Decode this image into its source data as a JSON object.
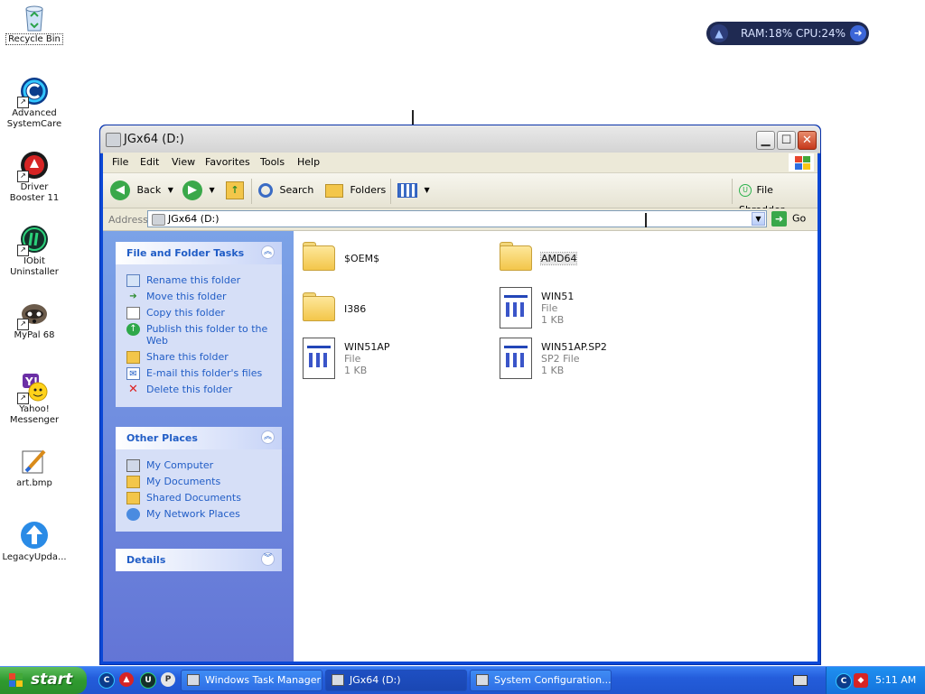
{
  "desktop": {
    "icons": [
      {
        "label": "Recycle Bin"
      },
      {
        "label": "Advanced SystemCare"
      },
      {
        "label": "Driver Booster 11"
      },
      {
        "label": "IObit Uninstaller"
      },
      {
        "label": "MyPal 68"
      },
      {
        "label": "Yahoo! Messenger"
      },
      {
        "label": "art.bmp"
      },
      {
        "label": "LegacyUpda..."
      }
    ]
  },
  "sysmon": {
    "text": "RAM:18% CPU:24%"
  },
  "window": {
    "title": "JGx64 (D:)",
    "menu": [
      "File",
      "Edit",
      "View",
      "Favorites",
      "Tools",
      "Help"
    ],
    "toolbar": {
      "back": "Back",
      "search": "Search",
      "folders": "Folders",
      "file_shredder": "File Shredder"
    },
    "address": {
      "label": "Address",
      "value": "JGx64 (D:)",
      "go": "Go"
    },
    "file_tasks": {
      "title": "File and Folder Tasks",
      "items": [
        "Rename this folder",
        "Move this folder",
        "Copy this folder",
        "Publish this folder to the Web",
        "Share this folder",
        "E-mail this folder's files",
        "Delete this folder"
      ]
    },
    "other_places": {
      "title": "Other Places",
      "items": [
        "My Computer",
        "My Documents",
        "Shared Documents",
        "My Network Places"
      ]
    },
    "details": {
      "title": "Details"
    },
    "files": [
      {
        "name": "$OEM$",
        "type": "",
        "size": ""
      },
      {
        "name": "AMD64",
        "type": "",
        "size": ""
      },
      {
        "name": "I386",
        "type": "",
        "size": ""
      },
      {
        "name": "WIN51",
        "type": "File",
        "size": "1 KB"
      },
      {
        "name": "WIN51AP",
        "type": "File",
        "size": "1 KB"
      },
      {
        "name": "WIN51AP.SP2",
        "type": "SP2 File",
        "size": "1 KB"
      }
    ]
  },
  "taskbar": {
    "start": "start",
    "tasks": [
      "Windows Task Manager",
      "JGx64 (D:)",
      "System Configuration..."
    ],
    "clock": "5:11 AM"
  }
}
